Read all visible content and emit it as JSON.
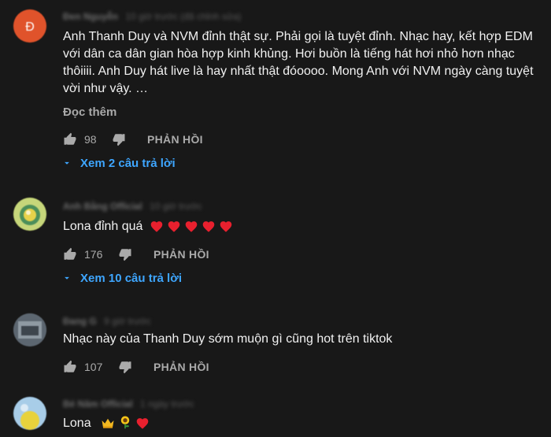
{
  "comments": [
    {
      "author": "Đen Nguyễn",
      "time": "10 giờ trước (đã chỉnh sửa)",
      "lines": [
        "Anh Thanh Duy và NVM đỉnh thật sự. Phải gọi là tuyệt đỉnh. Nhạc hay, kết hợp EDM",
        "với dân ca dân gian hòa hợp kinh khủng. Hơi buồn là tiếng hát hơi nhỏ hơn nhạc",
        "thôiiii. Anh Duy hát live là hay nhất thật đóoooo. Mong Anh với NVM ngày càng tuyệt",
        "vời như vậy. …"
      ],
      "read_more": "Đọc thêm",
      "likes": "98",
      "reply_label": "PHẢN HỒI",
      "replies_label": "Xem 2 câu trả lời",
      "avatar_color": "#e0532b"
    },
    {
      "author": "Anh Bằng Official",
      "time": "10 giờ trước",
      "text": "Lona đỉnh quá",
      "emojis": [
        "heart-emoji",
        "heart-emoji",
        "heart-emoji",
        "heart-emoji",
        "heart-emoji"
      ],
      "likes": "176",
      "reply_label": "PHẢN HỒI",
      "replies_label": "Xem 10 câu trả lời",
      "avatar_color": "#b8c85a"
    },
    {
      "author": "Đang G",
      "time": "9 giờ trước",
      "text": "Nhạc này của Thanh Duy sớm muộn gì cũng hot trên tiktok",
      "likes": "107",
      "reply_label": "PHẢN HỒI",
      "avatar_color": "#7a8590"
    },
    {
      "author": "Bé Năm Official",
      "time": "1 ngày trước",
      "text": "Lona",
      "emojis": [
        "crown-emoji",
        "sunflower-emoji",
        "heart-emoji"
      ],
      "avatar_color": "#7fb6e0"
    }
  ],
  "colors": {
    "background": "#181818",
    "text": "#f1f1f1",
    "secondary": "#aaaaaa",
    "link": "#3ea6ff",
    "heart": "#e8202e"
  }
}
